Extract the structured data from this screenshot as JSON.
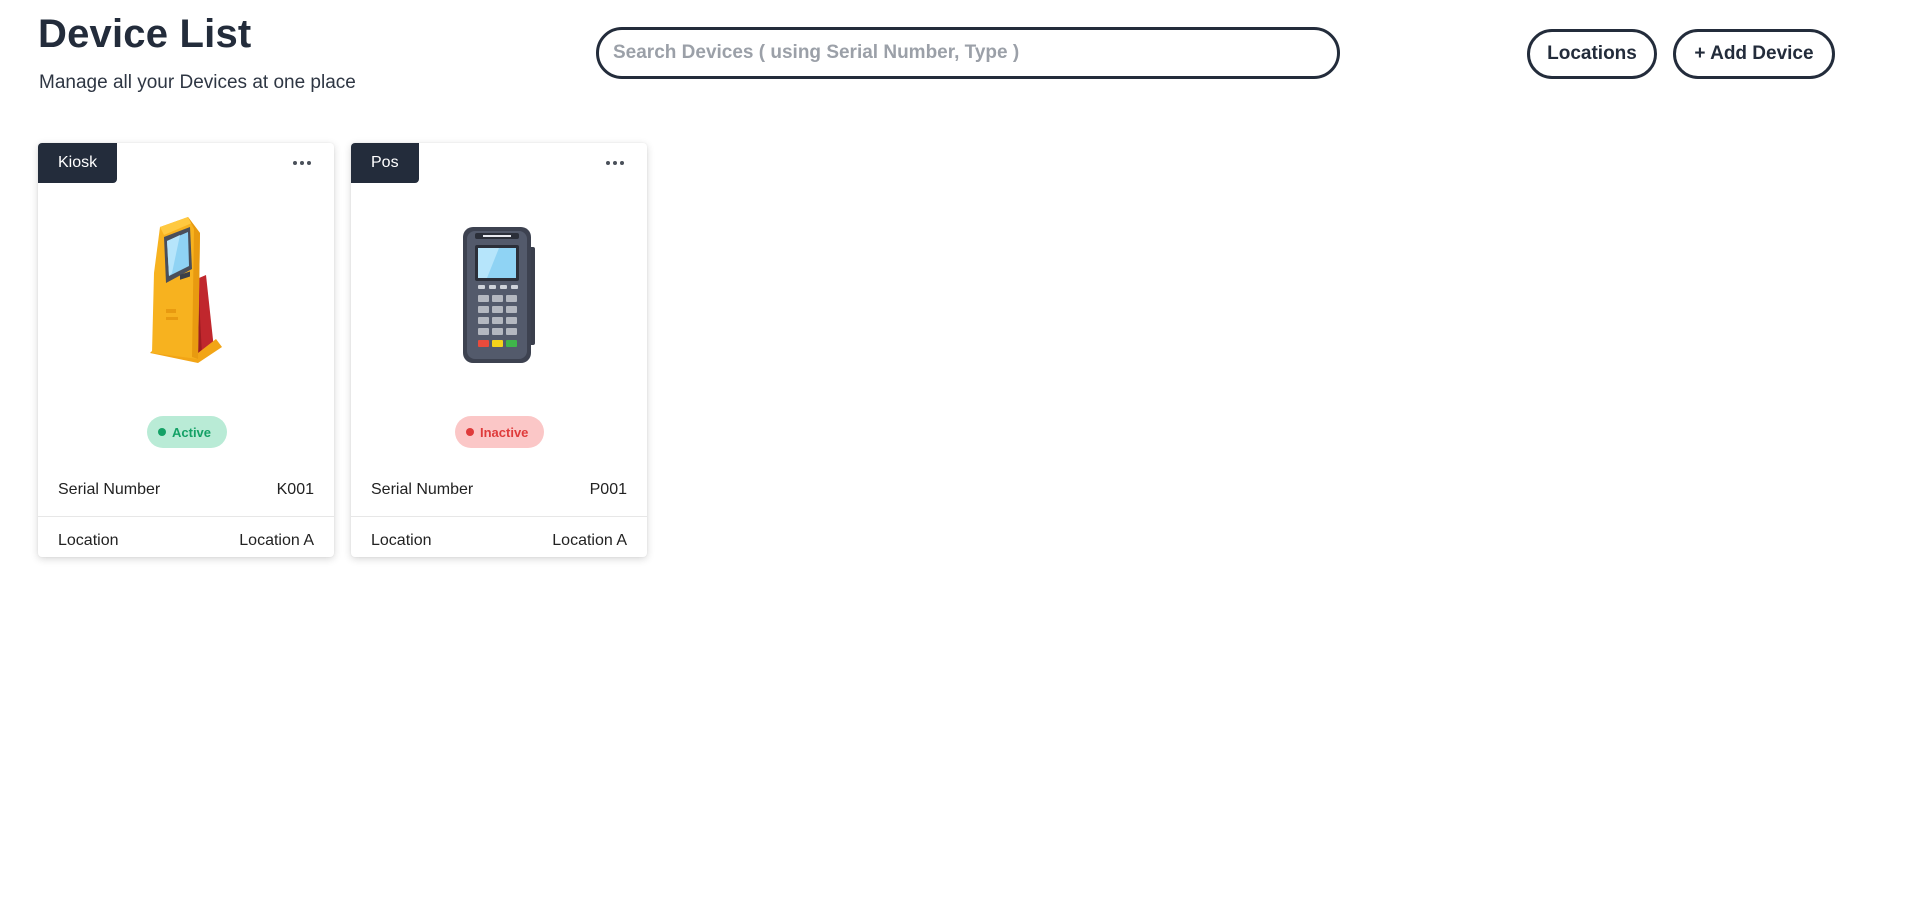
{
  "header": {
    "title": "Device List",
    "subtitle": "Manage all your Devices at one place",
    "search_placeholder": "Search Devices ( using Serial Number, Type )",
    "locations_label": "Locations",
    "add_device_label": "+ Add Device"
  },
  "devices": [
    {
      "type": "Kiosk",
      "icon": "kiosk-icon",
      "status": "Active",
      "status_color": "#14a166",
      "serial_label": "Serial Number",
      "serial": "K001",
      "location_label": "Location",
      "location": "Location A"
    },
    {
      "type": "Pos",
      "icon": "pos-terminal-icon",
      "status": "Inactive",
      "status_color": "#df3b3b",
      "serial_label": "Serial Number",
      "serial": "P001",
      "location_label": "Location",
      "location": "Location A"
    }
  ],
  "colors": {
    "primary": "#232c3b",
    "active": "#14a166",
    "inactive": "#df3b3b"
  }
}
